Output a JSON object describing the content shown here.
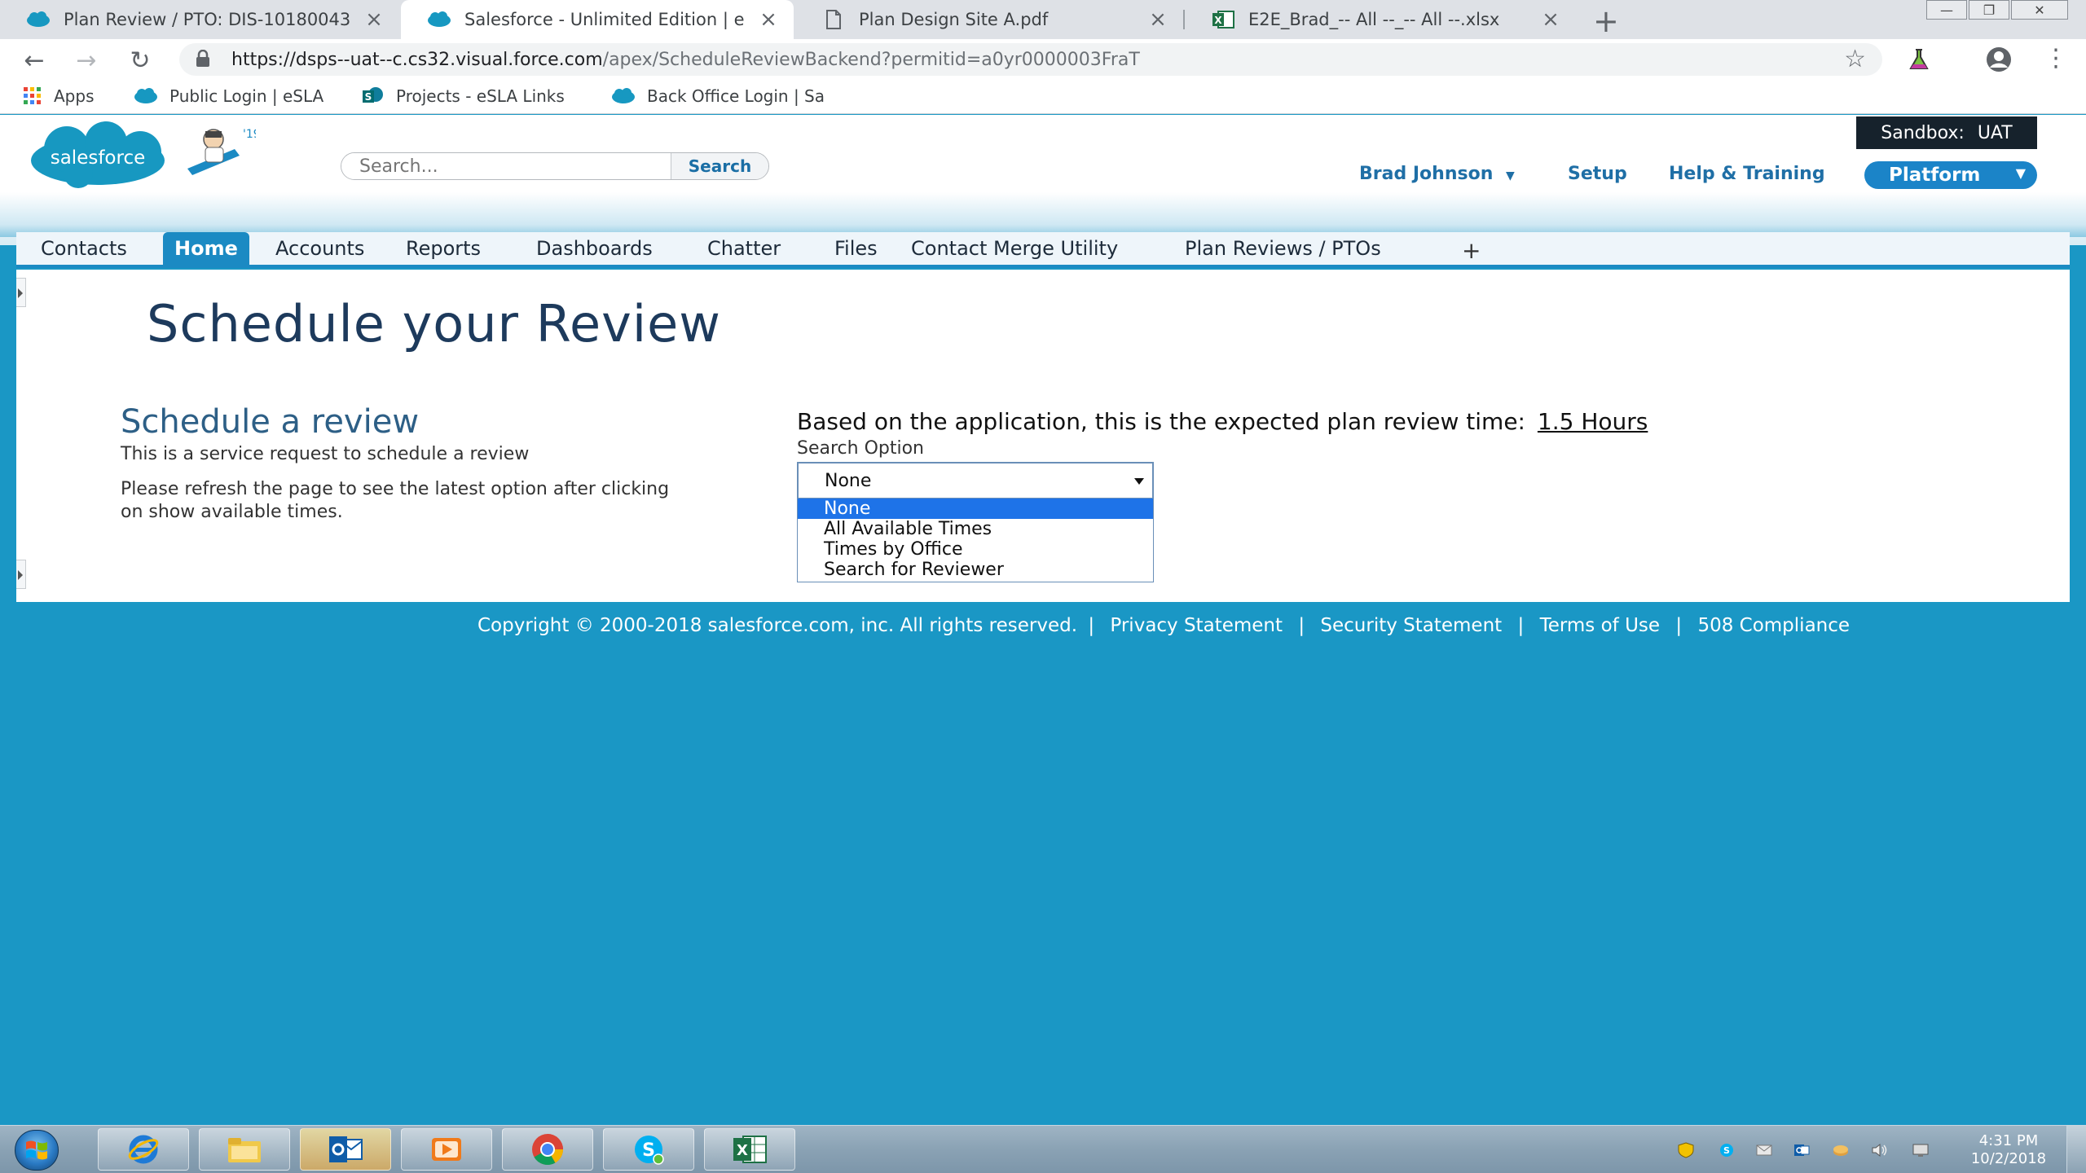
{
  "browser": {
    "tabs": [
      {
        "title": "Plan Review / PTO: DIS-10180043",
        "icon": "salesforce-cloud-icon"
      },
      {
        "title": "Salesforce - Unlimited Edition | e",
        "icon": "salesforce-cloud-icon"
      },
      {
        "title": "Plan Design Site A.pdf",
        "icon": "document-icon"
      },
      {
        "title": "E2E_Brad_-- All --_-- All --.xlsx",
        "icon": "excel-icon"
      }
    ],
    "url_host": "https://dsps--uat--c.cs32.visual.force.com",
    "url_path": "/apex/ScheduleReviewBackend?permitid=a0yr0000003FraT",
    "bookmarks": [
      {
        "label": "Apps",
        "icon": "apps-grid-icon"
      },
      {
        "label": "Public Login | eSLA",
        "icon": "salesforce-cloud-icon"
      },
      {
        "label": "Projects - eSLA Links",
        "icon": "sharepoint-icon"
      },
      {
        "label": "Back Office Login | Sa",
        "icon": "salesforce-cloud-icon"
      }
    ]
  },
  "header": {
    "logo_text": "salesforce",
    "mascot_badge": "'19",
    "search_placeholder": "Search...",
    "search_button": "Search",
    "sandbox_label": "Sandbox:",
    "sandbox_value": "UAT",
    "user_name": "Brad Johnson",
    "setup": "Setup",
    "help": "Help & Training",
    "app_menu": "Platform"
  },
  "nav_tabs": [
    "Contacts",
    "Home",
    "Accounts",
    "Reports",
    "Dashboards",
    "Chatter",
    "Files",
    "Contact Merge Utility",
    "Plan Reviews / PTOs",
    "+"
  ],
  "active_tab": "Home",
  "main": {
    "page_title": "Schedule your Review",
    "section_title": "Schedule a review",
    "description": "This is a service request to schedule a review",
    "refresh_note": "Please refresh the page to see the latest option after clicking on show available times.",
    "expected_text": "Based on the application, this is the expected plan review time:",
    "expected_value": "1.5 Hours",
    "search_option_label": "Search Option",
    "selected_option": "None",
    "options": [
      "None",
      "All Available Times",
      "Times by Office",
      "Search for Reviewer"
    ]
  },
  "footer": {
    "copyright": "Copyright © 2000-2018 salesforce.com, inc. All rights reserved.",
    "links": [
      "Privacy Statement",
      "Security Statement",
      "Terms of Use",
      "508 Compliance"
    ]
  },
  "taskbar": {
    "apps": [
      "internet-explorer-icon",
      "file-explorer-icon",
      "outlook-icon",
      "media-player-icon",
      "chrome-icon",
      "skype-icon",
      "excel-icon"
    ],
    "time": "4:31 PM",
    "date": "10/2/2018"
  },
  "colors": {
    "page_bg": "#1a97c5",
    "accent": "#1b8ac3",
    "title": "#1d3a5c",
    "dropdown_highlight": "#1e73e8"
  }
}
